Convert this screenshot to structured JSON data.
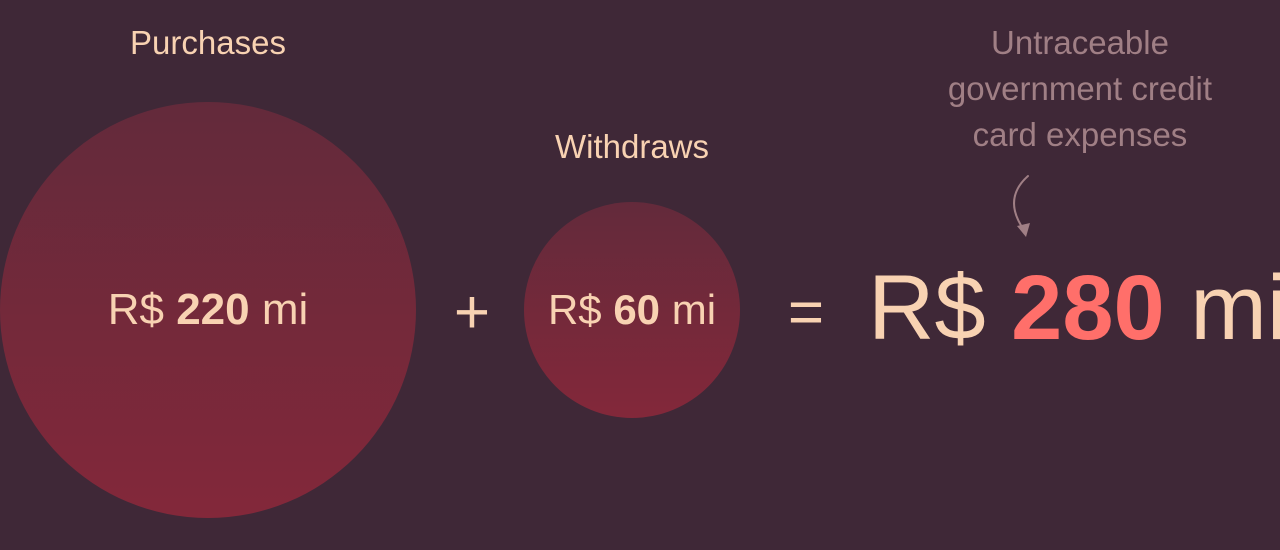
{
  "purchases": {
    "label": "Purchases",
    "currency": "R$",
    "value": "220",
    "unit": "mi"
  },
  "withdraws": {
    "label": "Withdraws",
    "currency": "R$",
    "value": "60",
    "unit": "mi"
  },
  "operators": {
    "plus": "+",
    "equals": "="
  },
  "total": {
    "currency": "R$",
    "value": "280",
    "unit": "mi"
  },
  "annotation": {
    "line1": "Untraceable",
    "line2": "government credit",
    "line3": "card expenses"
  },
  "colors": {
    "background": "#3f2837",
    "text": "#f8d2b2",
    "bubble_top": "#632a3b",
    "bubble_bottom": "#83283a",
    "highlight": "#ff6f6a",
    "annotation": "#a07f85"
  }
}
